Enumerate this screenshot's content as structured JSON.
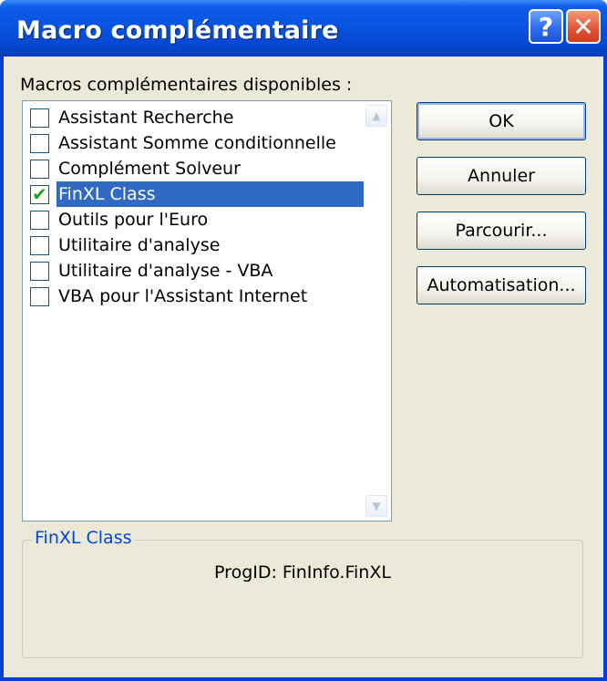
{
  "window": {
    "title": "Macro complémentaire",
    "help_glyph": "?",
    "close_glyph": "✕"
  },
  "list": {
    "label": "Macros complémentaires disponibles :",
    "items": [
      {
        "label": "Assistant Recherche",
        "checked": false,
        "selected": false
      },
      {
        "label": "Assistant Somme conditionnelle",
        "checked": false,
        "selected": false
      },
      {
        "label": "Complément Solveur",
        "checked": false,
        "selected": false
      },
      {
        "label": "FinXL Class",
        "checked": true,
        "selected": true
      },
      {
        "label": "Outils pour l'Euro",
        "checked": false,
        "selected": false
      },
      {
        "label": "Utilitaire d'analyse",
        "checked": false,
        "selected": false
      },
      {
        "label": "Utilitaire d'analyse - VBA",
        "checked": false,
        "selected": false
      },
      {
        "label": "VBA pour l'Assistant Internet",
        "checked": false,
        "selected": false
      }
    ],
    "check_glyph": "✔",
    "scroll_up_glyph": "▲",
    "scroll_down_glyph": "▼"
  },
  "buttons": {
    "ok": "OK",
    "cancel": "Annuler",
    "browse": "Parcourir...",
    "automation": "Automatisation..."
  },
  "details": {
    "title": "FinXL Class",
    "description": "ProgID: FinInfo.FinXL"
  },
  "colors": {
    "titlebar": "#0754e0",
    "selection": "#316ac5",
    "dialog_face": "#ece9d8",
    "group_title": "#0046d5",
    "checkmark": "#21a121"
  }
}
